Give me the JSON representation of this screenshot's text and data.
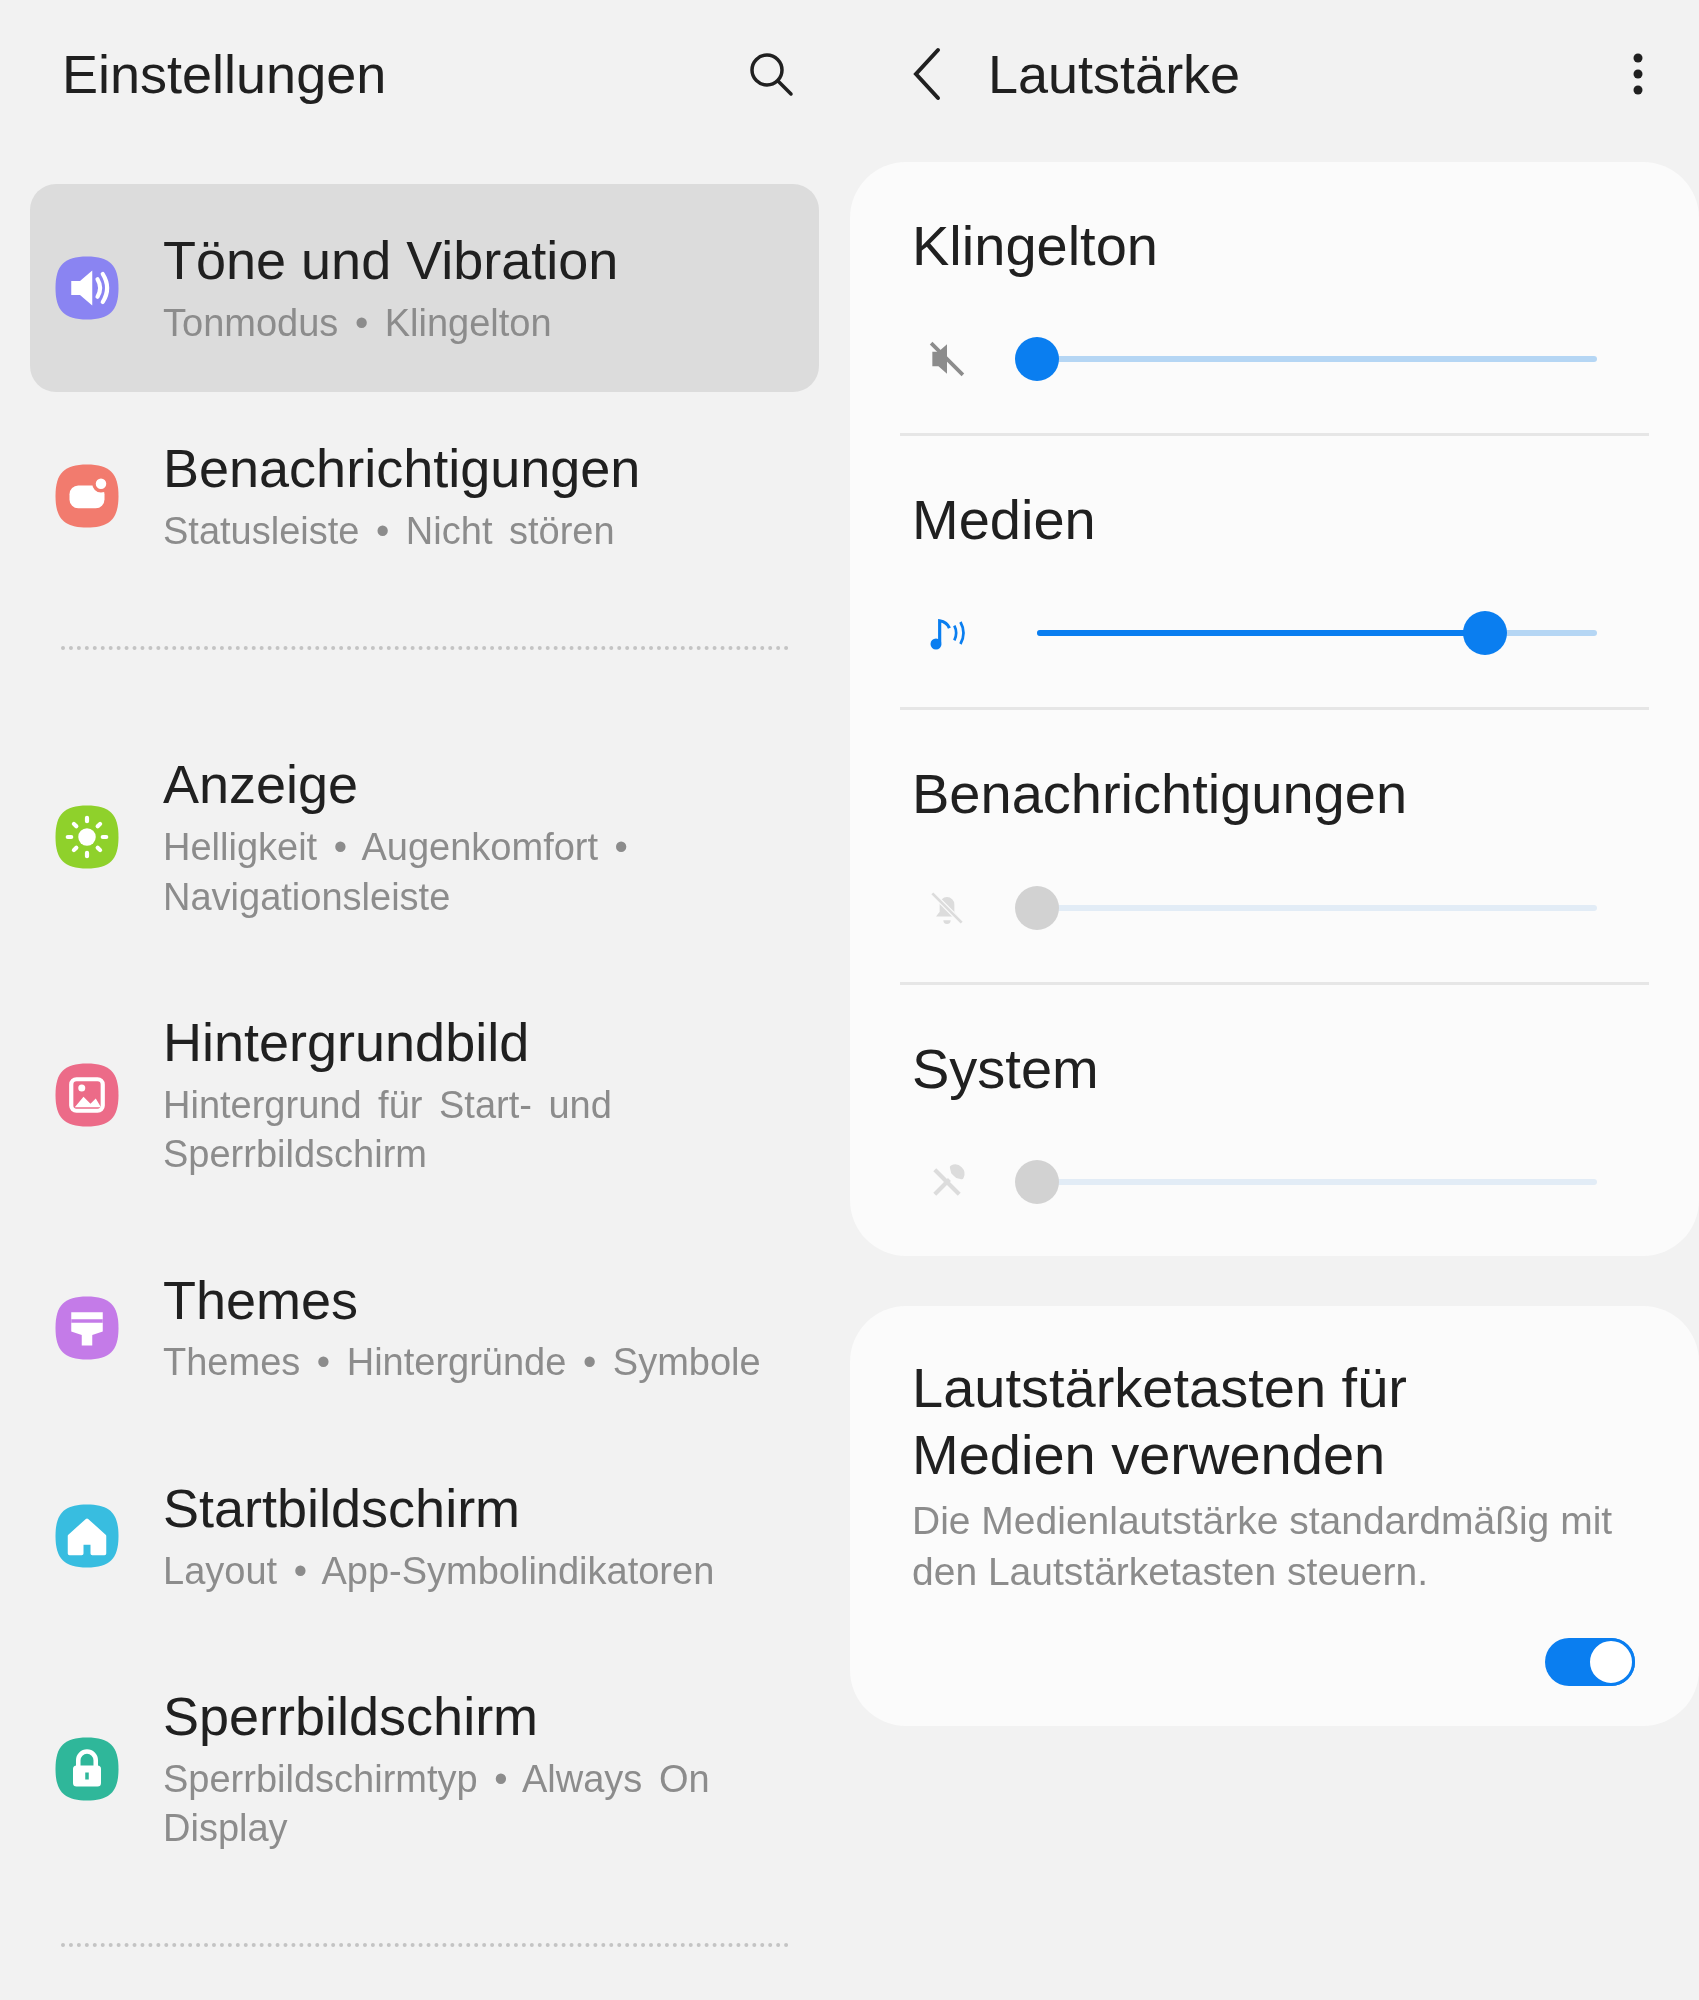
{
  "left_header": {
    "title": "Einstellungen"
  },
  "settings_groups": [
    [
      {
        "title": "Töne und Vibration",
        "subtitle": "Tonmodus • Klingelton",
        "color": "#8a84f2",
        "selected": true
      },
      {
        "title": "Benachrichtigungen",
        "subtitle": "Statusleiste • Nicht stören",
        "color": "#f27b6e",
        "selected": false
      }
    ],
    [
      {
        "title": "Anzeige",
        "subtitle": "Helligkeit • Augenkomfort • Navigationsleiste",
        "color": "#8fd12b",
        "selected": false
      },
      {
        "title": "Hintergrundbild",
        "subtitle": "Hintergrund für Start- und Sperrbildschirm",
        "color": "#ec6b88",
        "selected": false
      },
      {
        "title": "Themes",
        "subtitle": "Themes • Hintergründe • Symbole",
        "color": "#c47be8",
        "selected": false
      },
      {
        "title": "Startbildschirm",
        "subtitle": "Layout • App-Symbolindikatoren",
        "color": "#38bde0",
        "selected": false
      },
      {
        "title": "Sperrbildschirm",
        "subtitle": "Sperrbildschirmtyp • Always On Display",
        "color": "#2fb79a",
        "selected": false
      }
    ]
  ],
  "right_header": {
    "title": "Lautstärke"
  },
  "volumes": [
    {
      "name": "Klingelton",
      "level": 0,
      "disabled": false
    },
    {
      "name": "Medien",
      "level": 0.8,
      "disabled": false
    },
    {
      "name": "Benachrichtigungen",
      "level": 0,
      "disabled": true
    },
    {
      "name": "System",
      "level": 0,
      "disabled": true
    }
  ],
  "media_keys": {
    "title": "Lautstärketasten für Medien verwenden",
    "description": "Die Medienlautstärke standardmäßig mit den Lautstärketasten steuern.",
    "on": true
  }
}
